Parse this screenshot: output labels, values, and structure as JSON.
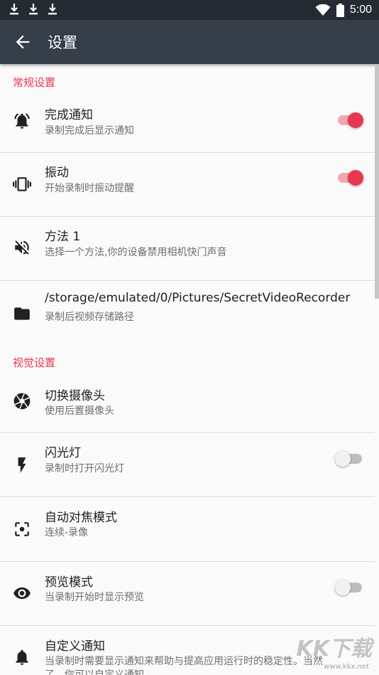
{
  "status_bar": {
    "time": "5:00",
    "icons": [
      "download-icon",
      "download-icon",
      "download-icon",
      "wifi-icon",
      "battery-icon"
    ]
  },
  "app_bar": {
    "title": "设置",
    "back_icon": "arrow-back-icon"
  },
  "sections": {
    "general": "常规设置",
    "visual": "视觉设置"
  },
  "settings": {
    "complete_notify": {
      "title": "完成通知",
      "subtitle": "录制完成后显示通知",
      "icon": "alarm-bell-icon",
      "enabled": true
    },
    "vibrate": {
      "title": "振动",
      "subtitle": "开始录制时振动提醒",
      "icon": "vibrate-icon",
      "enabled": true
    },
    "method": {
      "title": "方法 1",
      "subtitle": "选择一个方法,你的设备禁用相机快门声音",
      "icon": "volume-off-icon"
    },
    "storage": {
      "title": "/storage/emulated/0/Pictures/SecretVideoRecorder",
      "subtitle": "录制后视频存储路径",
      "icon": "folder-icon"
    },
    "switch_camera": {
      "title": "切换摄像头",
      "subtitle": "使用后置摄像头",
      "icon": "camera-iris-icon"
    },
    "flash": {
      "title": "闪光灯",
      "subtitle": "录制时打开闪光灯",
      "icon": "flash-icon",
      "enabled": false
    },
    "autofocus": {
      "title": "自动对焦模式",
      "subtitle": "连续-录像",
      "icon": "center-focus-icon"
    },
    "preview": {
      "title": "预览模式",
      "subtitle": "当录制开始时显示预览",
      "icon": "eye-icon",
      "enabled": false
    },
    "custom_notify": {
      "title": "自定义通知",
      "subtitle_line1": "当录制时需要显示通知来帮助与提高应用运行时的稳定性。当然",
      "subtitle_line2": "了，你可以自定义通知",
      "icon": "bell-icon"
    }
  },
  "colors": {
    "accent": "#e8384f",
    "status_bar": "#252b33",
    "app_bar": "#353e49"
  },
  "watermark": {
    "main": "KK下载",
    "url": "www.kkx.net"
  }
}
